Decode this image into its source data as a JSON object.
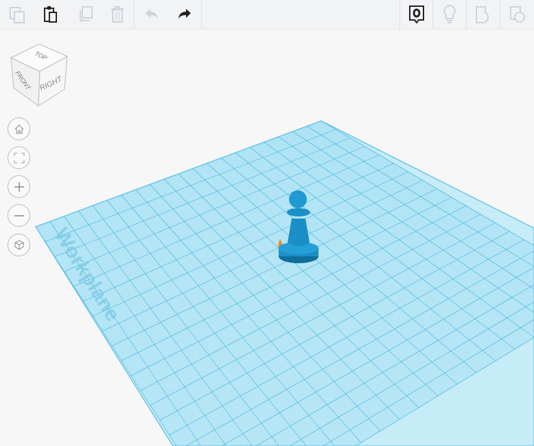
{
  "toolbar": {
    "buttons": [
      {
        "name": "copy",
        "icon": "copy-icon",
        "enabled": false
      },
      {
        "name": "paste",
        "icon": "paste-icon",
        "enabled": true
      },
      {
        "name": "duplicate",
        "icon": "duplicate-icon",
        "enabled": false
      },
      {
        "name": "delete",
        "icon": "trash-icon",
        "enabled": false
      },
      {
        "name": "undo",
        "icon": "undo-icon",
        "enabled": false
      },
      {
        "name": "redo",
        "icon": "redo-icon",
        "enabled": true
      }
    ],
    "right": [
      {
        "name": "notes",
        "icon": "eye-note-icon"
      },
      {
        "name": "light",
        "icon": "lightbulb-icon"
      },
      {
        "name": "shape",
        "icon": "shape-icon"
      },
      {
        "name": "group",
        "icon": "group-icon"
      }
    ]
  },
  "viewcube": {
    "top": "TOP",
    "front": "FRONT",
    "right": "RIGHT"
  },
  "workplane": {
    "label": "Workplane"
  },
  "colors": {
    "accent": "#1a8fc6",
    "grid": "#86d3ee",
    "orange": "#f08a1c"
  }
}
